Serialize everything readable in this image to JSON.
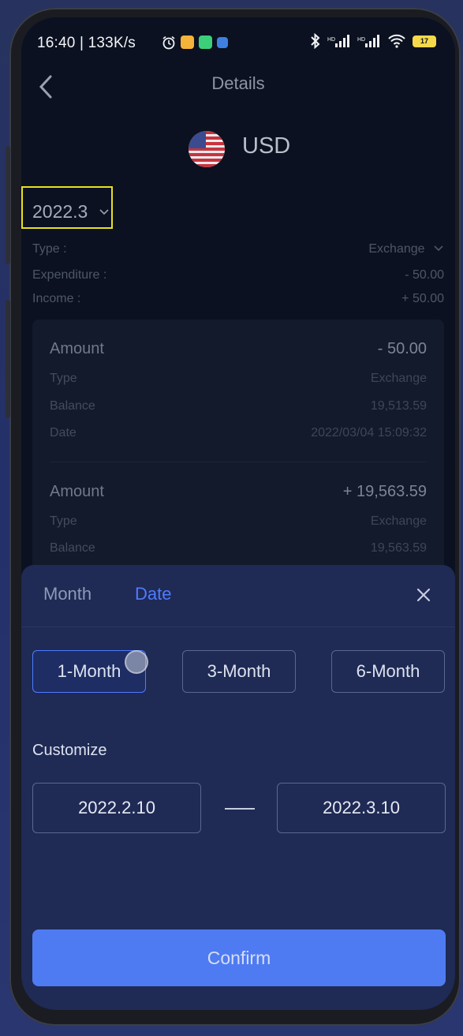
{
  "status_bar": {
    "time_speed": "16:40 | 133K/s",
    "battery": "17"
  },
  "nav": {
    "title": "Details"
  },
  "currency": {
    "code": "USD"
  },
  "filter": {
    "month": "2022.3"
  },
  "summary": {
    "type_label": "Type :",
    "type_value": "Exchange",
    "expenditure_label": "Expenditure :",
    "expenditure_value": "- 50.00",
    "income_label": "Income :",
    "income_value": "+ 50.00"
  },
  "transactions": [
    {
      "amount_label": "Amount",
      "amount": "- 50.00",
      "type_label": "Type",
      "type": "Exchange",
      "balance_label": "Balance",
      "balance": "19,513.59",
      "date_label": "Date",
      "date": "2022/03/04 15:09:32"
    },
    {
      "amount_label": "Amount",
      "amount": "+ 19,563.59",
      "type_label": "Type",
      "type": "Exchange",
      "balance_label": "Balance",
      "balance": "19,563.59"
    }
  ],
  "sheet": {
    "tab_month": "Month",
    "tab_date": "Date",
    "active_tab": "Date",
    "ranges": [
      "1-Month",
      "3-Month",
      "6-Month"
    ],
    "selected_range": "1-Month",
    "customize_label": "Customize",
    "start_date": "2022.2.10",
    "end_date": "2022.3.10",
    "confirm_label": "Confirm"
  },
  "colors": {
    "accent": "#4f7bff",
    "confirm_bg": "#4f7bf2",
    "sheet_bg": "#1f2a55",
    "screen_bg": "#0b1120",
    "highlight_box": "#e8e020"
  },
  "icons": [
    "back-arrow-icon",
    "us-flag-icon",
    "chevron-down-icon",
    "close-icon",
    "bluetooth-icon",
    "signal-icon",
    "wifi-icon",
    "battery-icon",
    "alarm-icon"
  ]
}
